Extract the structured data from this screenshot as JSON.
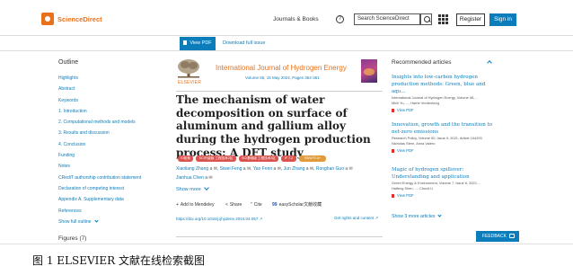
{
  "header": {
    "logo_text": "ScienceDirect",
    "journals_books": "Journals & Books",
    "help_glyph": "?",
    "search_placeholder": "Search ScienceDirect",
    "register": "Register",
    "sign_in": "Sign in",
    "brand_color": "#e9711c",
    "accent_color": "#0c7dbb"
  },
  "actionbar": {
    "view_pdf": "View PDF",
    "download_full_issue": "Download full issue"
  },
  "outline": {
    "title": "Outline",
    "items": [
      "Highlights",
      "Abstract",
      "Keywords",
      "1. Introduction",
      "2. Computational methods and models",
      "3. Results and discussion",
      "4. Conclusion",
      "Funding",
      "Notes",
      "CRediT authorship contribution statement",
      "Declaration of competing interest",
      "Appendix A. Supplementary data",
      "References"
    ],
    "show_full_outline": "Show full outline",
    "figures": "Figures (7)"
  },
  "article": {
    "publisher_label": "ELSEVIER",
    "journal_title": "International Journal of Hydrogen Energy",
    "volume_info": "Volume 66, 15 May 2024, Pages 354-361",
    "title": "The mechanism of water decomposition on surface of aluminum and gallium alloy during the hydrogen production process: A DFT study",
    "badges": [
      {
        "label": "EI检索",
        "color": "#d9534f"
      },
      {
        "label": "SCI升级版 工程技术2区",
        "color": "#d9534f"
      },
      {
        "label": "SCI基础版 工程技术3区",
        "color": "#d9534f"
      },
      {
        "label": "IF 7.2",
        "color": "#d9534f"
      },
      {
        "label": "SWUFE A+",
        "color": "#e29a3a"
      }
    ],
    "authors_line1": "Xiaoliang Zhang ",
    "authors_line1_more": ", Siwei Feng ",
    "authors_line1_c": ", Yao Fenn ",
    "authors_line1_d": ", Jun Zhang ",
    "authors_line1_e": ", Ronghan Guo ",
    "authors_line2": "Jianhua Chen ",
    "author_icons": "a ✉",
    "show_more": "Show more",
    "add_to_mendeley": "Add to Mendeley",
    "share": "Share",
    "cite": "Cite",
    "easyscholar": "easyScholar文献收藏",
    "doi": "https://doi.org/10.1016/j.ijhydene.2024.04.057",
    "rights": "Get rights and content"
  },
  "recommended": {
    "title": "Recommended articles",
    "items": [
      {
        "title": "Insights into low-carbon hydrogen production methods: Green, blue and aqu...",
        "journal": "International Journal of Hydrogen Energy, Volume 46,...",
        "authors": "Minli Yu, ..., Harrie Vredenburg",
        "pdf": "View PDF"
      },
      {
        "title": "Innovation, growth and the transition to net-zero emissions",
        "journal": "Research Policy, Volume 50, Issue 9, 2021, Article 104293",
        "authors": "Nicholas Stern, Anna Valero",
        "pdf": "View PDF"
      },
      {
        "title": "Magic of hydrogen spillover: Understanding and application",
        "journal": "Green Energy & Environment, Volume 7, Issue 6, 2022,...",
        "authors": "Haifeng Shen, ..., Chunli Li",
        "pdf": "View PDF"
      }
    ],
    "show_more": "Show 3 more articles"
  },
  "feedback": "FEEDBACK",
  "caption": "图 1 ELSEVIER 文献在线检索截图"
}
